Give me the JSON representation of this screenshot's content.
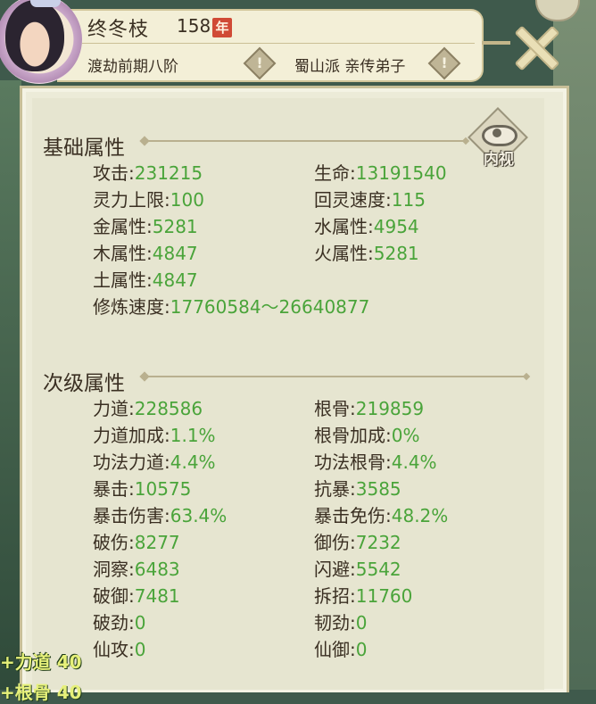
{
  "header": {
    "name": "终冬枝",
    "age": "158",
    "age_badge": "年",
    "realm": "渡劫前期八阶",
    "sect": "蜀山派 亲传弟子",
    "warn_glyph": "!"
  },
  "inner_view": {
    "label": "内视",
    "icon": "eye-icon"
  },
  "basic": {
    "title": "基础属性",
    "stats": [
      {
        "label": "攻击",
        "value": "231215"
      },
      {
        "label": "生命",
        "value": "13191540"
      },
      {
        "label": "灵力上限",
        "value": "100"
      },
      {
        "label": "回灵速度",
        "value": "115"
      },
      {
        "label": "金属性",
        "value": "5281"
      },
      {
        "label": "水属性",
        "value": "4954"
      },
      {
        "label": "木属性",
        "value": "4847"
      },
      {
        "label": "火属性",
        "value": "5281"
      },
      {
        "label": "土属性",
        "value": "4847"
      },
      {
        "label": "修炼速度",
        "value": "17760584～26640877"
      }
    ]
  },
  "secondary": {
    "title": "次级属性",
    "stats": [
      {
        "label": "力道",
        "value": "228586"
      },
      {
        "label": "根骨",
        "value": "219859"
      },
      {
        "label": "力道加成",
        "value": "1.1%"
      },
      {
        "label": "根骨加成",
        "value": "0%"
      },
      {
        "label": "功法力道",
        "value": "4.4%"
      },
      {
        "label": "功法根骨",
        "value": "4.4%"
      },
      {
        "label": "暴击",
        "value": "10575"
      },
      {
        "label": "抗暴",
        "value": "3585"
      },
      {
        "label": "暴击伤害",
        "value": "63.4%"
      },
      {
        "label": "暴击免伤",
        "value": "48.2%"
      },
      {
        "label": "破伤",
        "value": "8277"
      },
      {
        "label": "御伤",
        "value": "7232"
      },
      {
        "label": "洞察",
        "value": "6483"
      },
      {
        "label": "闪避",
        "value": "5542"
      },
      {
        "label": "破御",
        "value": "7481"
      },
      {
        "label": "拆招",
        "value": "11760"
      },
      {
        "label": "破劲",
        "value": "0"
      },
      {
        "label": "韧劲",
        "value": "0"
      },
      {
        "label": "仙攻",
        "value": "0"
      },
      {
        "label": "仙御",
        "value": "0"
      }
    ]
  },
  "floating": {
    "buff1": "+力道 40",
    "buff2": "+根骨 40"
  },
  "colors": {
    "value_green": "#4aa43a",
    "label_dark": "#3a2f22",
    "age_badge_red": "#d04a35"
  }
}
